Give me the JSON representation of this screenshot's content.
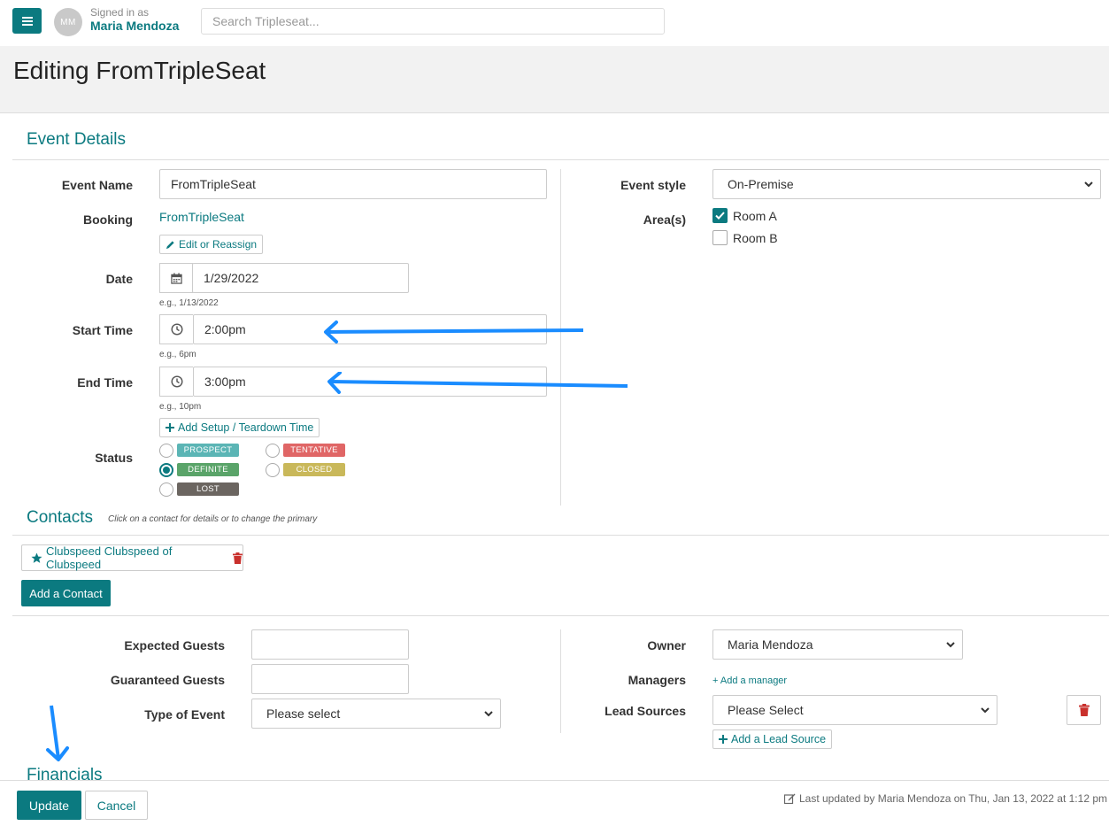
{
  "header": {
    "avatar_initials": "MM",
    "signed_in_label": "Signed in as",
    "user_name": "Maria Mendoza",
    "search_placeholder": "Search Tripleseat..."
  },
  "page": {
    "title": "Editing FromTripleSeat"
  },
  "event_details": {
    "section_title": "Event Details",
    "event_name_label": "Event Name",
    "event_name_value": "FromTripleSeat",
    "booking_label": "Booking",
    "booking_link": "FromTripleSeat",
    "edit_reassign_label": "Edit or Reassign",
    "date_label": "Date",
    "date_value": "1/29/2022",
    "date_hint": "e.g., 1/13/2022",
    "start_time_label": "Start Time",
    "start_time_value": "2:00pm",
    "start_time_hint": "e.g., 6pm",
    "end_time_label": "End Time",
    "end_time_value": "3:00pm",
    "end_time_hint": "e.g., 10pm",
    "add_setup_label": "Add Setup / Teardown Time",
    "status_label": "Status",
    "statuses": [
      {
        "label": "PROSPECT",
        "color": "#5bb5b5",
        "checked": false
      },
      {
        "label": "TENTATIVE",
        "color": "#e06666",
        "checked": false
      },
      {
        "label": "DEFINITE",
        "color": "#5aa469",
        "checked": true
      },
      {
        "label": "CLOSED",
        "color": "#c9b85a",
        "checked": false
      },
      {
        "label": "LOST",
        "color": "#6b6560",
        "checked": false
      }
    ],
    "event_style_label": "Event style",
    "event_style_value": "On-Premise",
    "areas_label": "Area(s)",
    "areas": [
      {
        "label": "Room A",
        "checked": true
      },
      {
        "label": "Room B",
        "checked": false
      }
    ]
  },
  "contacts": {
    "section_title": "Contacts",
    "hint": "Click on a contact for details or to change the primary",
    "primary_contact": "Clubspeed Clubspeed of Clubspeed",
    "add_contact_label": "Add a Contact"
  },
  "details": {
    "expected_guests_label": "Expected Guests",
    "expected_guests_value": "",
    "guaranteed_guests_label": "Guaranteed Guests",
    "guaranteed_guests_value": "",
    "type_of_event_label": "Type of Event",
    "type_of_event_value": "Please select",
    "owner_label": "Owner",
    "owner_value": "Maria Mendoza",
    "managers_label": "Managers",
    "add_manager_label": "+ Add a manager",
    "lead_sources_label": "Lead Sources",
    "lead_sources_value": "Please Select",
    "add_lead_source_label": "Add a Lead Source"
  },
  "financials": {
    "section_title": "Financials"
  },
  "footer": {
    "update_label": "Update",
    "cancel_label": "Cancel",
    "last_updated": "Last updated by Maria Mendoza on Thu, Jan 13, 2022 at 1:12 pm"
  },
  "colors": {
    "accent": "#0b7a80",
    "annotation_arrow": "#1a8cff",
    "danger": "#c9302c"
  }
}
